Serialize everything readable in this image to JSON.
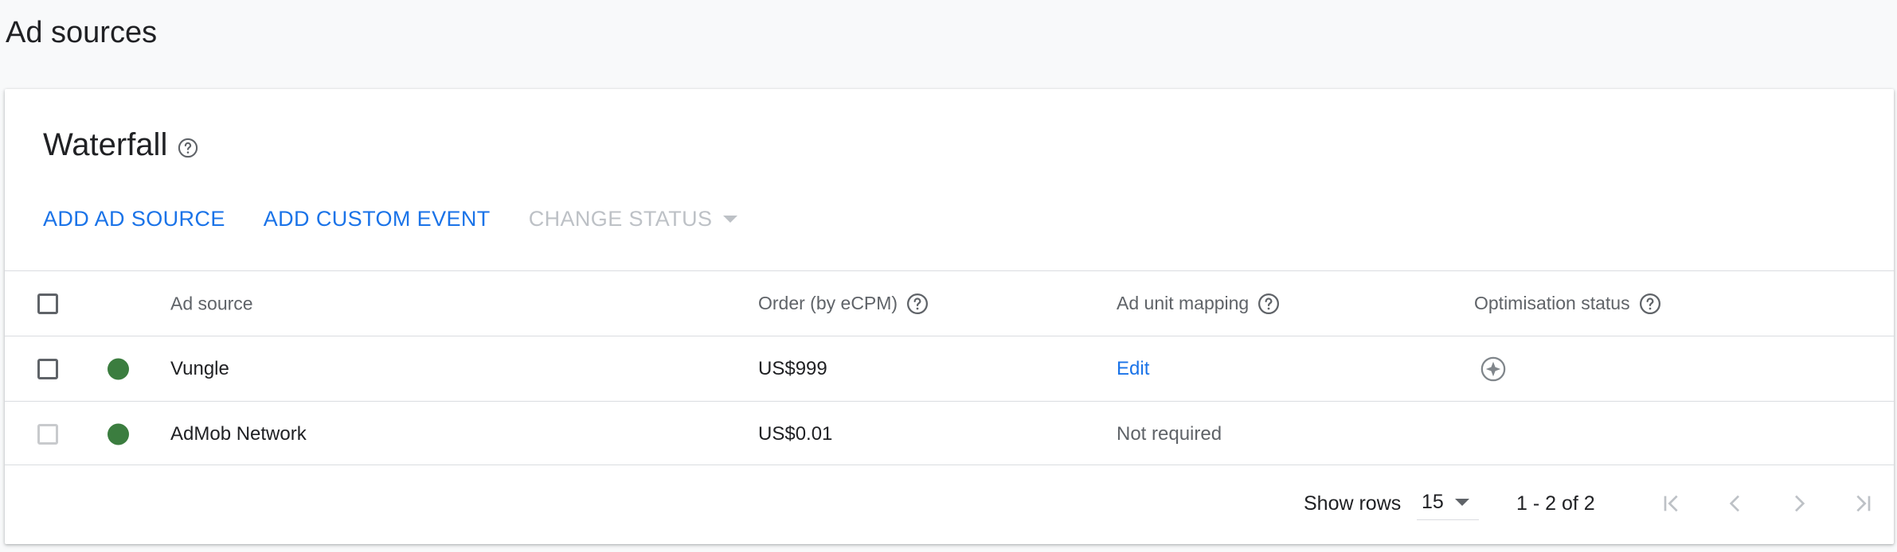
{
  "page": {
    "title": "Ad sources"
  },
  "card": {
    "title": "Waterfall",
    "actions": {
      "add_ad_source": "ADD AD SOURCE",
      "add_custom_event": "ADD CUSTOM EVENT",
      "change_status": "CHANGE STATUS"
    }
  },
  "table": {
    "headers": {
      "ad_source": "Ad source",
      "order": "Order (by eCPM)",
      "mapping": "Ad unit mapping",
      "optimisation": "Optimisation status"
    },
    "rows": [
      {
        "name": "Vungle",
        "order": "US$999",
        "mapping": "Edit",
        "status_color": "#3b7d3f"
      },
      {
        "name": "AdMob Network",
        "order": "US$0.01",
        "mapping": "Not required",
        "status_color": "#3b7d3f"
      }
    ]
  },
  "footer": {
    "show_rows_label": "Show rows",
    "rows_per_page": "15",
    "range": "1 - 2 of 2"
  },
  "colors": {
    "accent": "#1a73e8",
    "disabled": "#bdc1c6",
    "status_active": "#3b7d3f"
  }
}
